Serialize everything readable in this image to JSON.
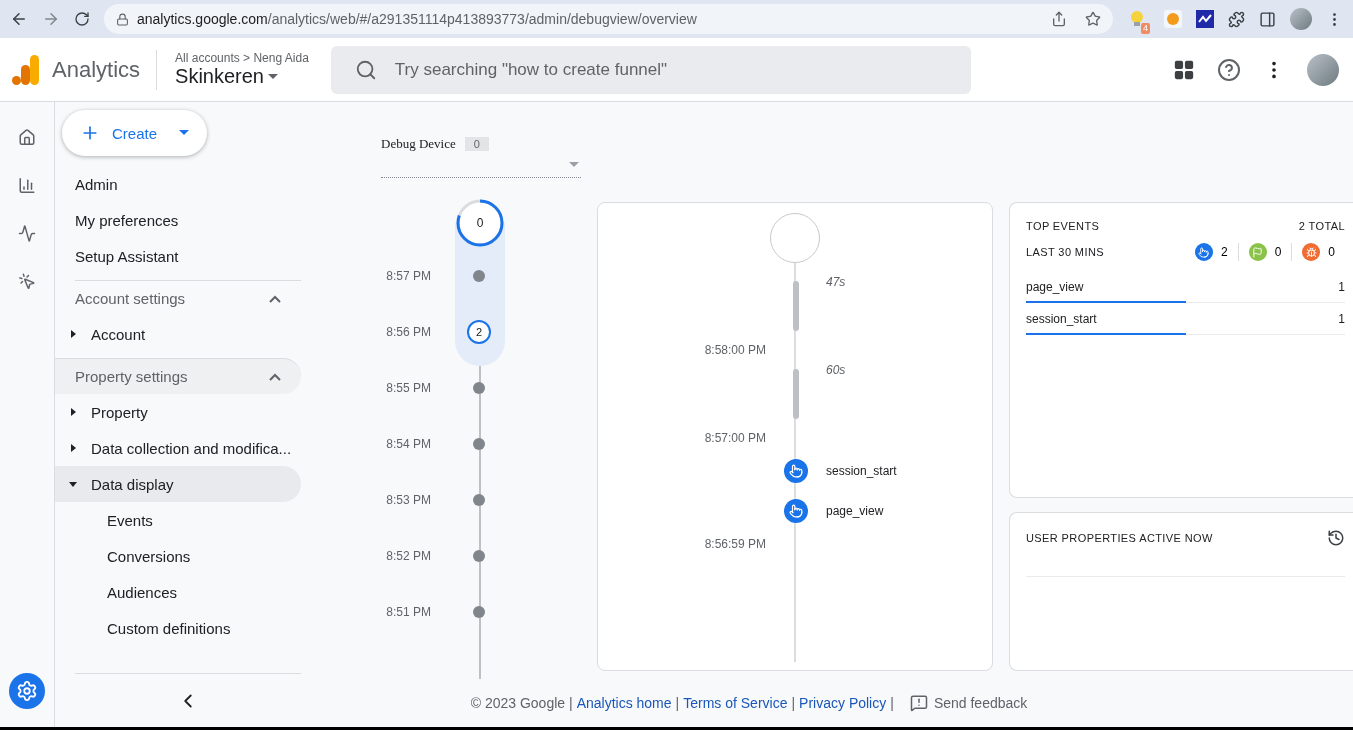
{
  "browser": {
    "url_host": "analytics.google.com",
    "url_path": "/analytics/web/#/a291351114p413893773/admin/debugview/overview",
    "extension_badge": "4"
  },
  "header": {
    "product": "Analytics",
    "breadcrumb": "All accounts > Neng Aida",
    "property": "Skinkeren",
    "search_placeholder": "Try searching \"how to create funnel\""
  },
  "rail": [
    {
      "kind": "home",
      "selected": false
    },
    {
      "kind": "reports",
      "selected": false
    },
    {
      "kind": "explore",
      "selected": false
    },
    {
      "kind": "advertising",
      "selected": false
    },
    {
      "kind": "admin",
      "selected": true
    }
  ],
  "create_button": "Create",
  "nav": [
    {
      "kind": "link",
      "label": "Admin",
      "selected": false
    },
    {
      "kind": "link",
      "label": "My preferences",
      "selected": false
    },
    {
      "kind": "link",
      "label": "Setup Assistant",
      "selected": false
    },
    {
      "kind": "section",
      "label": "Account settings",
      "expanded": true,
      "selected": false
    },
    {
      "kind": "group",
      "label": "Account",
      "expanded": false,
      "selected": false
    },
    {
      "kind": "section",
      "label": "Property settings",
      "expanded": true,
      "selected": true
    },
    {
      "kind": "group",
      "label": "Property",
      "expanded": false,
      "selected": false
    },
    {
      "kind": "group",
      "label": "Data collection and modifica...",
      "expanded": false,
      "selected": false
    },
    {
      "kind": "group",
      "label": "Data display",
      "expanded": true,
      "selected": true,
      "children": [
        {
          "kind": "child",
          "label": "Events",
          "selected": false
        },
        {
          "kind": "child",
          "label": "Conversions",
          "selected": false
        },
        {
          "kind": "child",
          "label": "Audiences",
          "selected": false
        },
        {
          "kind": "child",
          "label": "Custom definitions",
          "selected": false
        }
      ]
    }
  ],
  "debug_device": {
    "label": "Debug Device",
    "count": "0"
  },
  "minutes": {
    "top_count": "0",
    "rows": [
      {
        "time": "8:57 PM",
        "in_range": true
      },
      {
        "time": "8:56 PM",
        "in_range": true,
        "count": "2"
      },
      {
        "time": "8:55 PM",
        "in_range": false
      },
      {
        "time": "8:54 PM",
        "in_range": false
      },
      {
        "time": "8:53 PM",
        "in_range": false
      },
      {
        "time": "8:52 PM",
        "in_range": false
      },
      {
        "time": "8:51 PM",
        "in_range": false
      }
    ]
  },
  "seconds": [
    {
      "kind": "gap",
      "label": "47s"
    },
    {
      "kind": "time",
      "label": "8:58:00 PM"
    },
    {
      "kind": "gap",
      "label": "60s"
    },
    {
      "kind": "time",
      "label": "8:57:00 PM"
    },
    {
      "kind": "event",
      "label": "session_start"
    },
    {
      "kind": "event",
      "label": "page_view"
    },
    {
      "kind": "time",
      "label": "8:56:59 PM"
    }
  ],
  "top_events": {
    "title": "TOP EVENTS",
    "total": "2 TOTAL",
    "period": "LAST 30 MINS",
    "counters": [
      {
        "kind": "event",
        "count": "2",
        "color": "#1a73e8"
      },
      {
        "kind": "conversion",
        "count": "0",
        "color": "#8bc34a"
      },
      {
        "kind": "error",
        "count": "0",
        "color": "#ef6c33"
      }
    ],
    "rows": [
      {
        "name": "page_view",
        "count": "1",
        "level": 0.5
      },
      {
        "name": "session_start",
        "count": "1",
        "level": 0.5
      }
    ]
  },
  "user_properties": {
    "title": "USER PROPERTIES ACTIVE NOW"
  },
  "footer": [
    {
      "kind": "text",
      "label": "© 2023 Google |"
    },
    {
      "kind": "link",
      "label": "Analytics home"
    },
    {
      "kind": "text",
      "label": "|"
    },
    {
      "kind": "link",
      "label": "Terms of Service"
    },
    {
      "kind": "text",
      "label": "|"
    },
    {
      "kind": "link",
      "label": "Privacy Policy"
    },
    {
      "kind": "text",
      "label": "|"
    },
    {
      "kind": "feedback",
      "label": "Send feedback"
    }
  ]
}
